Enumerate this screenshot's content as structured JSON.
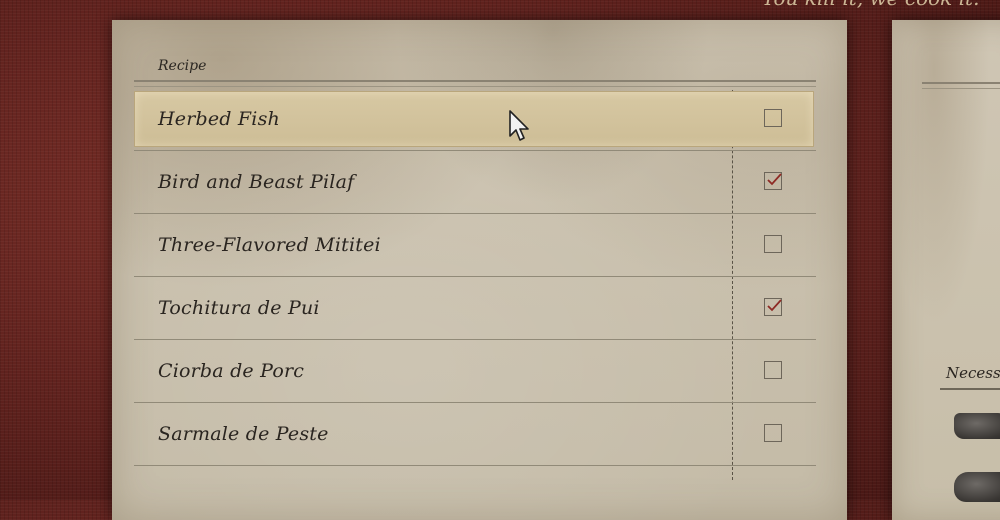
{
  "tagline": "You kill it, we cook it.",
  "recipe_panel": {
    "header": "Recipe",
    "recipes": [
      {
        "name": "Herbed Fish",
        "checked": false,
        "selected": true
      },
      {
        "name": "Bird and Beast Pilaf",
        "checked": true,
        "selected": false
      },
      {
        "name": "Three-Flavored Mititei",
        "checked": false,
        "selected": false
      },
      {
        "name": "Tochitura de Pui",
        "checked": true,
        "selected": false
      },
      {
        "name": "Ciorba de Porc",
        "checked": false,
        "selected": false
      },
      {
        "name": "Sarmale de Peste",
        "checked": false,
        "selected": false
      }
    ]
  },
  "detail_panel": {
    "section_label": "Necessar"
  },
  "colors": {
    "background": "#5e211d",
    "paper": "#c9c0ad",
    "highlight": "#d2c29c",
    "check": "#8e2a24",
    "ink": "#2a2520"
  }
}
